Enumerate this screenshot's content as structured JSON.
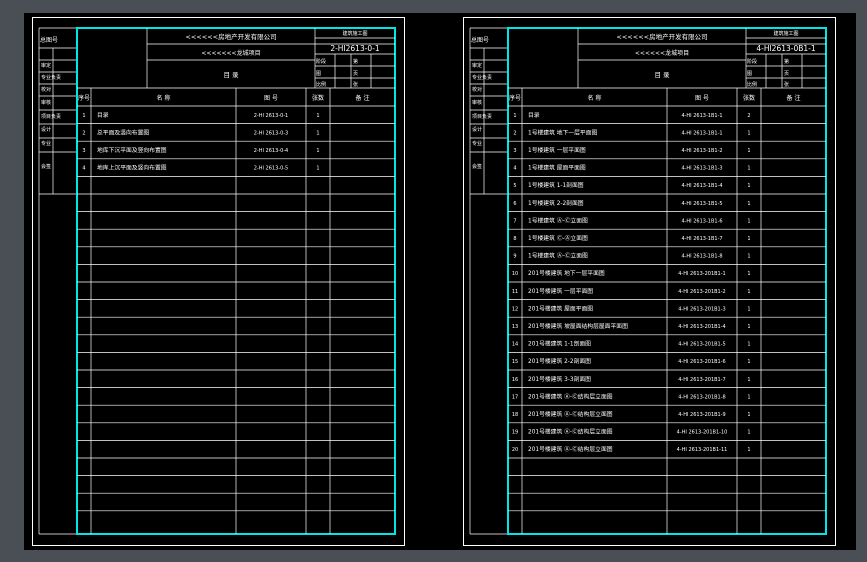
{
  "sheets": [
    {
      "company": "<<<<<<房地产开发有限公司",
      "project": "<<<<<<<龙城项目",
      "doc_title": "目 录",
      "code_header": "建筑施工图",
      "code": "2-HI2613-0-1",
      "meta_labels": [
        "阶段",
        "图",
        "比例",
        "第",
        "页",
        "张"
      ],
      "left_labels": [
        "总图号",
        "审定",
        "专业负责",
        "校对",
        "审核",
        "项目负责",
        "设计",
        "专业",
        "会签",
        "设计"
      ],
      "col_headers": [
        "序号",
        "名 称",
        "图 号",
        "张数",
        "备 注"
      ],
      "rows": [
        {
          "no": "1",
          "name": "目录",
          "code": "2-HI 2613-0-1",
          "count": "1"
        },
        {
          "no": "2",
          "name": "总平面及竖向布置图",
          "code": "2-HI 2613-0-3",
          "count": "1"
        },
        {
          "no": "3",
          "name": "地库下沉平面及竖向布置图",
          "code": "2-HI 2613-0-4",
          "count": "1"
        },
        {
          "no": "4",
          "name": "地库上沉平面及竖向布置图",
          "code": "2-HI 2613-0-5",
          "count": "1"
        }
      ]
    },
    {
      "company": "<<<<<<房地产开发有限公司",
      "project": "<<<<<<龙城项目",
      "doc_title": "目 录",
      "code_header": "建筑施工图",
      "code": "4-HI2613-0B1-1",
      "meta_labels": [
        "阶段",
        "图",
        "比例",
        "第",
        "页",
        "张"
      ],
      "left_labels": [
        "总图号",
        "审定",
        "专业负责",
        "校对",
        "审核",
        "项目负责",
        "设计",
        "专业",
        "会签",
        "设计"
      ],
      "col_headers": [
        "序号",
        "名 称",
        "图 号",
        "张数",
        "备 注"
      ],
      "rows": [
        {
          "no": "1",
          "name": "目录",
          "code": "4-HI 2613-1B1-1",
          "count": "2"
        },
        {
          "no": "2",
          "name": "1号楼建筑 地下一层平面图",
          "code": "4-HI 2613-1B1-1",
          "count": "1"
        },
        {
          "no": "3",
          "name": "1号楼建筑 一层平面图",
          "code": "4-HI 2613-1B1-2",
          "count": "1"
        },
        {
          "no": "4",
          "name": "1号楼建筑 屋面平面图",
          "code": "4-HI 2613-1B1-3",
          "count": "1"
        },
        {
          "no": "5",
          "name": "1号楼建筑 1-1剖面图",
          "code": "4-HI 2613-1B1-4",
          "count": "1"
        },
        {
          "no": "6",
          "name": "1号楼建筑 2-2剖面图",
          "code": "4-HI 2613-1B1-5",
          "count": "1"
        },
        {
          "no": "7",
          "name": "1号楼建筑 Ⓐ-Ⓒ立面图",
          "code": "4-HI 2613-1B1-6",
          "count": "1"
        },
        {
          "no": "8",
          "name": "1号楼建筑 Ⓒ-Ⓐ立面图",
          "code": "4-HI 2613-1B1-7",
          "count": "1"
        },
        {
          "no": "9",
          "name": "1号楼建筑 Ⓐ-Ⓒ立面图",
          "code": "4-HI 2613-1B1-8",
          "count": "1"
        },
        {
          "no": "10",
          "name": "201号楼建筑 地下一层平面图",
          "code": "4-HI 2613-201B1-1",
          "count": "1"
        },
        {
          "no": "11",
          "name": "201号楼建筑 一层平面图",
          "code": "4-HI 2613-201B1-2",
          "count": "1"
        },
        {
          "no": "12",
          "name": "201号楼建筑 屋面平面图",
          "code": "4-HI 2613-201B1-3",
          "count": "1"
        },
        {
          "no": "13",
          "name": "201号楼建筑 坡屋面结构层屋面平面图",
          "code": "4-HI 2613-201B1-4",
          "count": "1"
        },
        {
          "no": "14",
          "name": "201号楼建筑 1-1剖面图",
          "code": "4-HI 2613-201B1-5",
          "count": "1"
        },
        {
          "no": "15",
          "name": "201号楼建筑 2-2剖面图",
          "code": "4-HI 2613-201B1-6",
          "count": "1"
        },
        {
          "no": "16",
          "name": "201号楼建筑 3-3剖面图",
          "code": "4-HI 2613-201B1-7",
          "count": "1"
        },
        {
          "no": "17",
          "name": "201号楼建筑 Ⓐ-Ⓒ结构层立面图",
          "code": "4-HI 2613-201B1-8",
          "count": "1"
        },
        {
          "no": "18",
          "name": "201号楼建筑 Ⓐ-Ⓒ结构层立面图",
          "code": "4-HI 2613-201B1-9",
          "count": "1"
        },
        {
          "no": "19",
          "name": "201号楼建筑 Ⓐ-Ⓒ结构层立面图",
          "code": "4-HI 2613-201B1-10",
          "count": "1"
        },
        {
          "no": "20",
          "name": "201号楼建筑 Ⓐ-Ⓒ结构层立面图",
          "code": "4-HI 2613-201B1-11",
          "count": "1"
        }
      ]
    }
  ],
  "colors": {
    "border": "#00e5e5",
    "line": "#ffffff",
    "background": "#000000",
    "frame": "#4a4f55"
  }
}
